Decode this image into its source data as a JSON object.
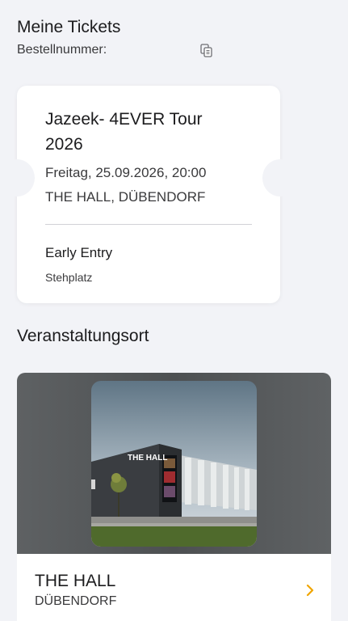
{
  "header": {
    "title": "Meine Tickets",
    "order_label": "Bestellnummer:"
  },
  "ticket": {
    "event_title": "Jazeek- 4EVER Tour 2026",
    "date": "Freitag, 25.09.2026, 20:00",
    "venue": "THE HALL, DÜBENDORF",
    "type": "Early Entry",
    "subtype": "Stehplatz"
  },
  "venue_section": {
    "title": "Veranstaltungsort",
    "name": "THE HALL",
    "city": "DÜBENDORF",
    "photo_sign": "THE HALL"
  },
  "colors": {
    "background": "#f2f3f7",
    "card": "#ffffff",
    "chevron": "#f0a500"
  }
}
